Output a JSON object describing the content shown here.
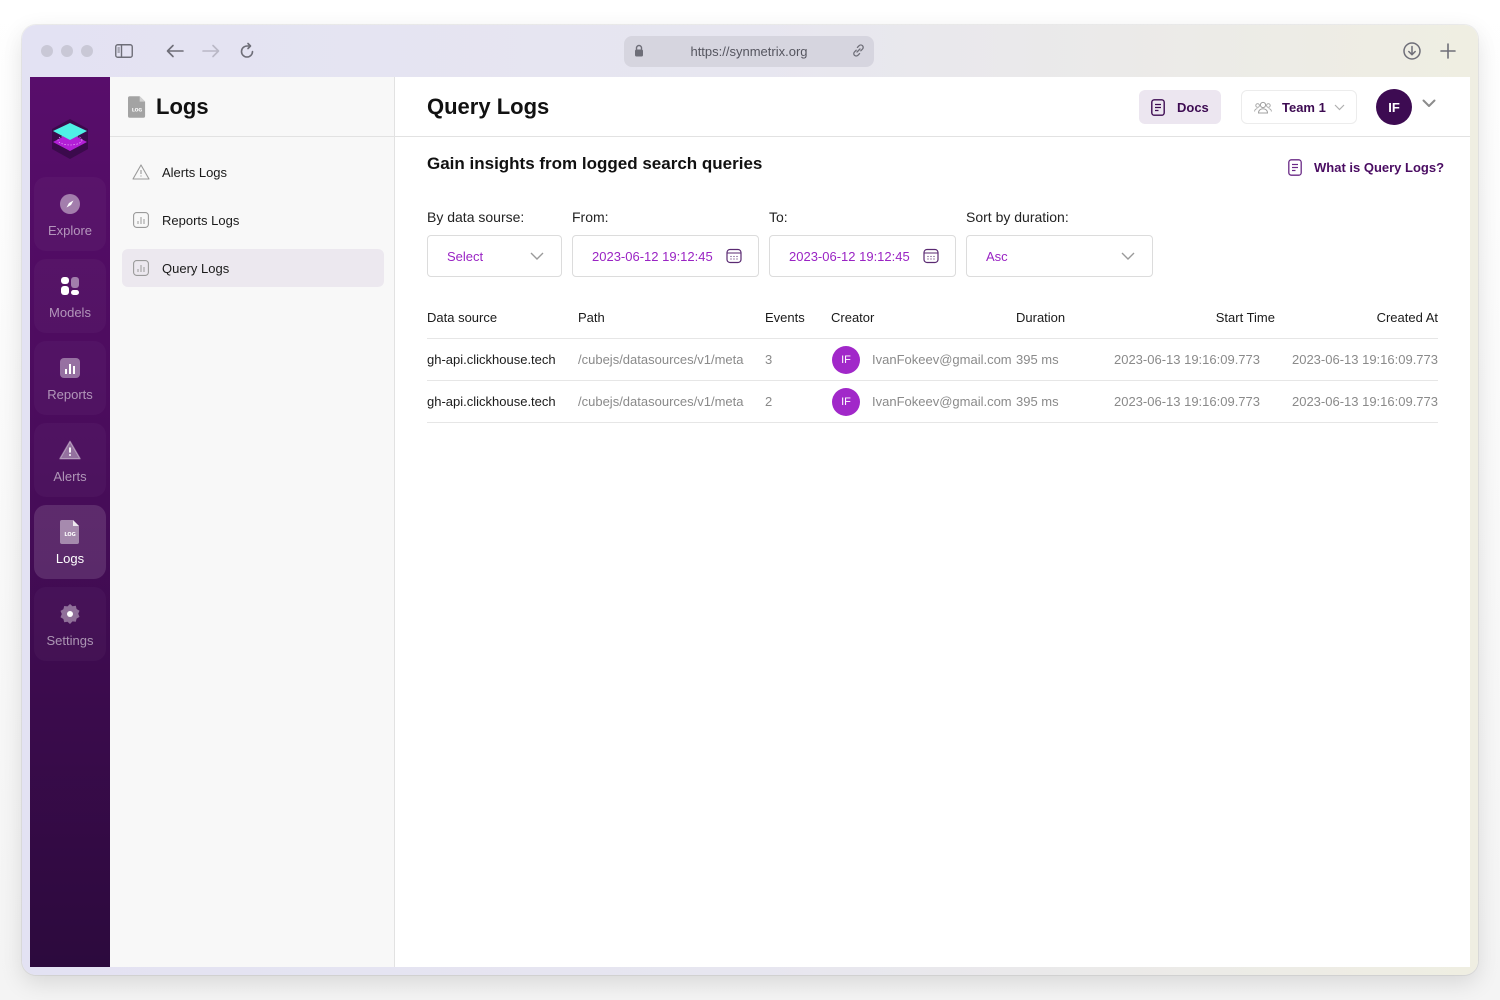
{
  "browser": {
    "url": "https://synmetrix.org"
  },
  "rail": {
    "items": [
      {
        "label": "Explore",
        "icon": "compass-icon",
        "active": false
      },
      {
        "label": "Models",
        "icon": "models-icon",
        "active": false
      },
      {
        "label": "Reports",
        "icon": "bar-chart-icon",
        "active": false
      },
      {
        "label": "Alerts",
        "icon": "warning-icon",
        "active": false
      },
      {
        "label": "Logs",
        "icon": "log-file-icon",
        "active": true
      },
      {
        "label": "Settings",
        "icon": "gear-icon",
        "active": false
      }
    ]
  },
  "subnav": {
    "title": "Logs",
    "items": [
      {
        "label": "Alerts Logs",
        "icon": "warning-outline-icon",
        "active": false
      },
      {
        "label": "Reports Logs",
        "icon": "chart-outline-icon",
        "active": false
      },
      {
        "label": "Query Logs",
        "icon": "chart-outline-icon",
        "active": true
      }
    ]
  },
  "header": {
    "title": "Query Logs",
    "docs_label": "Docs",
    "team_label": "Team 1",
    "avatar_initials": "IF"
  },
  "page": {
    "subtitle": "Gain insights from logged search queries",
    "help_link": "What is Query Logs?"
  },
  "filters": {
    "data_source": {
      "label": "By data sourse:",
      "value": "Select"
    },
    "from": {
      "label": "From:",
      "value": "2023-06-12 19:12:45"
    },
    "to": {
      "label": "To:",
      "value": "2023-06-12 19:12:45"
    },
    "sort": {
      "label": "Sort by duration:",
      "value": "Asc"
    }
  },
  "table": {
    "columns": [
      "Data source",
      "Path",
      "Events",
      "Creator",
      "Duration",
      "Start Time",
      "Created At"
    ],
    "rows": [
      {
        "data_source": "gh-api.clickhouse.tech",
        "path": "/cubejs/datasources/v1/meta",
        "events": "3",
        "creator_initials": "IF",
        "creator": "IvanFokeev@gmail.com",
        "duration": "395 ms",
        "start_time": "2023-06-13 19:16:09.773",
        "created_at": "2023-06-13 19:16:09.773"
      },
      {
        "data_source": "gh-api.clickhouse.tech",
        "path": "/cubejs/datasources/v1/meta",
        "events": "2",
        "creator_initials": "IF",
        "creator": "IvanFokeev@gmail.com",
        "duration": "395 ms",
        "start_time": "2023-06-13 19:16:09.773",
        "created_at": "2023-06-13 19:16:09.773"
      }
    ]
  },
  "colors": {
    "brand_dark": "#3d0b52",
    "accent": "#9a24c4",
    "rail_top": "#580d6b",
    "rail_bottom": "#2c0a3d",
    "avatar_small": "#a128c9"
  }
}
